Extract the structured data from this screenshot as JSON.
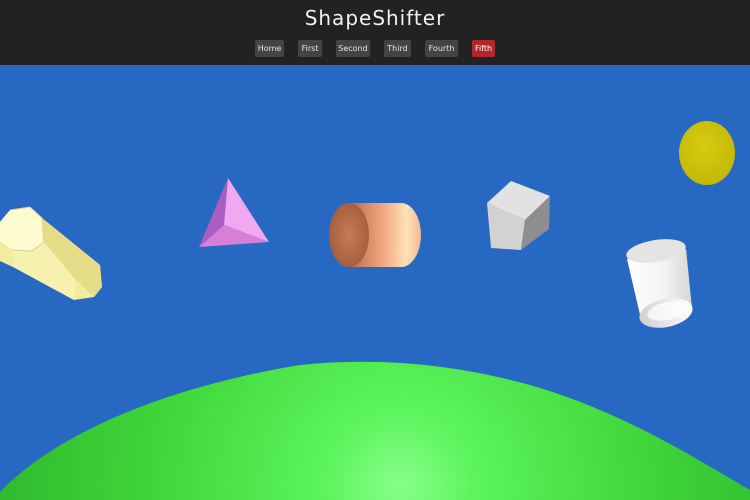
{
  "site": {
    "title": "ShapeShifter"
  },
  "nav": {
    "items": [
      {
        "label": "Home",
        "active": false
      },
      {
        "label": "First",
        "active": false
      },
      {
        "label": "Second",
        "active": false
      },
      {
        "label": "Third",
        "active": false
      },
      {
        "label": "Fourth",
        "active": false
      },
      {
        "label": "Fifth",
        "active": true
      }
    ]
  },
  "scene": {
    "sky_color": "#2769c2",
    "ground_color": "#3fd83a",
    "shapes": [
      {
        "name": "yellow-hexagonal-prism",
        "color": "#f6f1a6"
      },
      {
        "name": "pink-pyramid",
        "color": "#d97fd9"
      },
      {
        "name": "copper-cylinder",
        "color": "#e8966f"
      },
      {
        "name": "gray-cube",
        "color": "#c9c9c9"
      },
      {
        "name": "yellow-disc",
        "color": "#cdc40a"
      },
      {
        "name": "white-tube",
        "color": "#f2f2f2"
      }
    ]
  }
}
